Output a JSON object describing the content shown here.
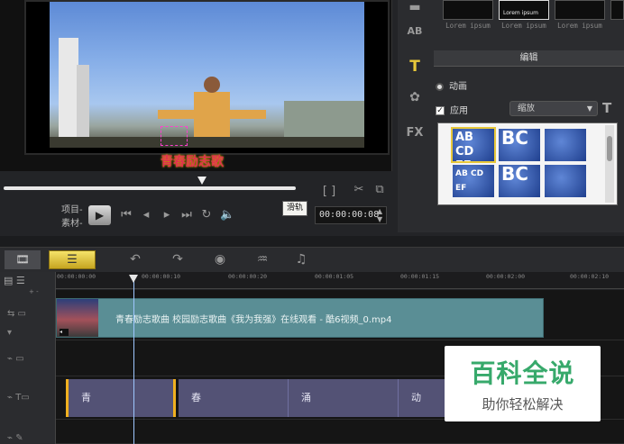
{
  "preview": {
    "overlay_text": "青春励志歌",
    "mode_project": "项目-",
    "mode_clip": "素材-",
    "tooltip": "滑轨",
    "timecode": "00:00:00:08",
    "progress_fraction": 0.68
  },
  "right_panel": {
    "thumb_labels": [
      "Lorem ipsum",
      "Lorem ipsum",
      "Lorem ipsum"
    ],
    "thumb_selected_text": "Lorem ipsum",
    "edit_header": "编辑",
    "option_dong": "动画",
    "option_apply": "应用",
    "combo_value": "缩放",
    "presets": [
      "AB CD EF GH",
      "BC",
      "",
      "AB CD EF",
      "BC",
      ""
    ],
    "side_tools": [
      "AB",
      "T",
      "FX"
    ]
  },
  "toolbar": {
    "storyboard_icon": "film-icon",
    "timeline_icon": "timeline-icon"
  },
  "ruler": {
    "labels": [
      "00:00:00:00",
      "00:00:00:10",
      "00:00:00:20",
      "00:00:01:05",
      "00:00:01:15",
      "00:00:02:00",
      "00:00:02:10"
    ]
  },
  "tracks": {
    "video_clip_name": "青春励志歌曲 校园励志歌曲《我为我强》在线观看 - 酷6视频_0.mp4",
    "title_clips": [
      "青",
      "春",
      "涌",
      "动"
    ]
  },
  "watermark": {
    "title": "百科全说",
    "subtitle": "助你轻松解决"
  },
  "colors": {
    "timeline_button": "#e6c53a",
    "video_clip": "#5a8e95",
    "title_clip": "#535275",
    "watermark_green": "#37a96b"
  }
}
